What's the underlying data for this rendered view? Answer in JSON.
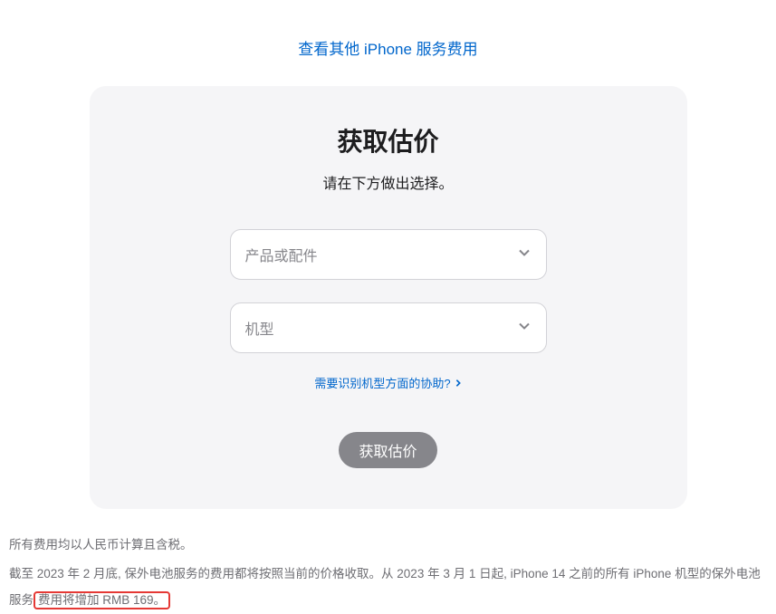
{
  "top_link": "查看其他 iPhone 服务费用",
  "card": {
    "title": "获取估价",
    "subtitle": "请在下方做出选择。",
    "select_product_placeholder": "产品或配件",
    "select_model_placeholder": "机型",
    "help_link": "需要识别机型方面的协助?",
    "button_label": "获取估价"
  },
  "footer": {
    "line1": "所有费用均以人民币计算且含税。",
    "line2_a": "截至 2023 年 2 月底, 保外电池服务的费用都将按照当前的价格收取。从 2023 年 3 月 1 日起, iPhone 14 之前的所有 iPhone 机型的保外电池服务",
    "line2_b": "费用将增加 RMB 169。"
  }
}
